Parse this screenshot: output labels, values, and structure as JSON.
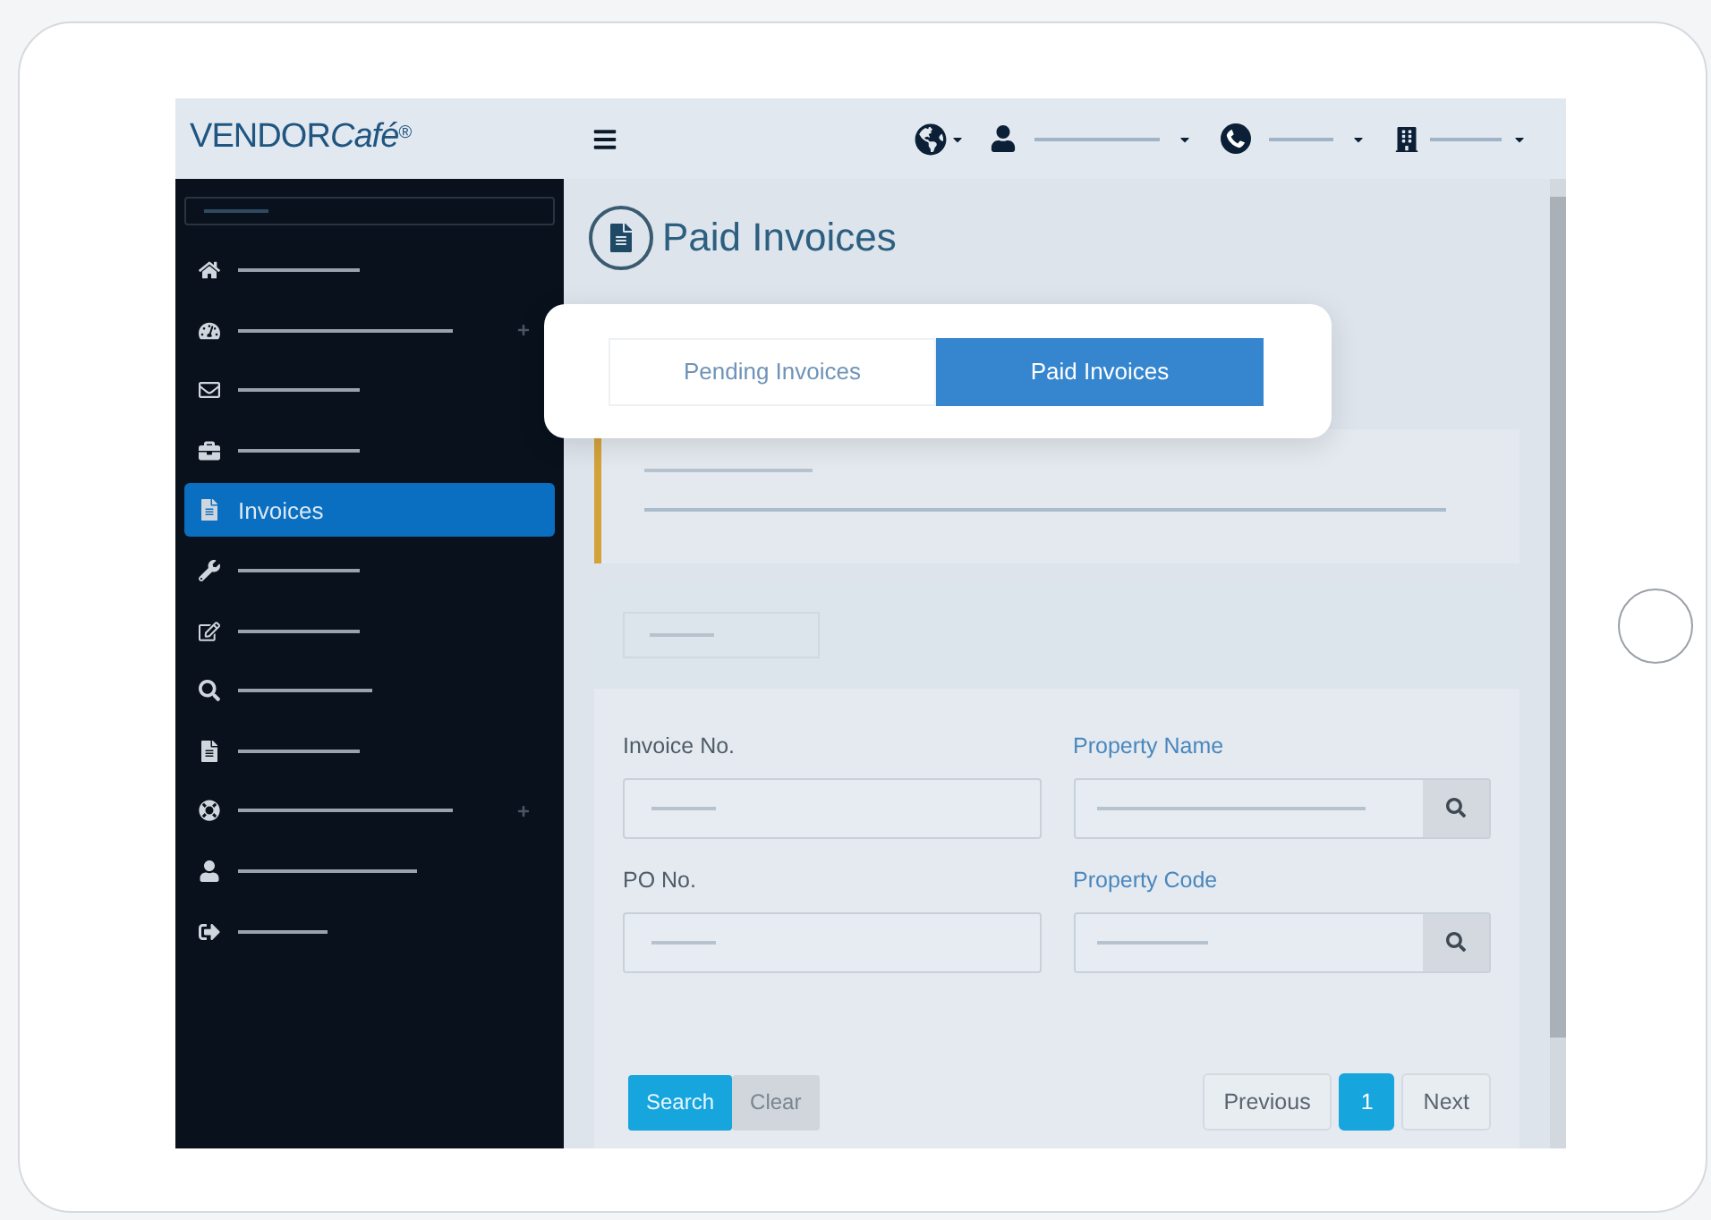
{
  "header": {
    "logo": {
      "name": "VENDOR",
      "suffix": "Café",
      "mark": "®"
    }
  },
  "sidebar": {
    "items": [
      {
        "selected": false,
        "expandable": false
      },
      {
        "selected": false,
        "expandable": true
      },
      {
        "selected": false,
        "expandable": false
      },
      {
        "selected": false,
        "expandable": false
      },
      {
        "selected": true,
        "expandable": false,
        "label": "Invoices"
      },
      {
        "selected": false,
        "expandable": false
      },
      {
        "selected": false,
        "expandable": false
      },
      {
        "selected": false,
        "expandable": false
      },
      {
        "selected": false,
        "expandable": false
      },
      {
        "selected": false,
        "expandable": true
      },
      {
        "selected": false,
        "expandable": false
      },
      {
        "selected": false,
        "expandable": false
      }
    ]
  },
  "page": {
    "title": "Paid Invoices"
  },
  "tabs": [
    {
      "label": "Pending Invoices",
      "selected": false
    },
    {
      "label": "Paid Invoices",
      "selected": true
    }
  ],
  "form": {
    "fields": [
      {
        "label": "Invoice No.",
        "kind": "text"
      },
      {
        "label": "Property Name",
        "kind": "lookup"
      },
      {
        "label": "PO No.",
        "kind": "text"
      },
      {
        "label": "Property Code",
        "kind": "lookup"
      }
    ],
    "buttons": [
      {
        "label": "Search",
        "kind": "primary"
      },
      {
        "label": "Clear",
        "kind": "secondary"
      }
    ]
  },
  "pagination": [
    {
      "label": "Previous",
      "selected": false
    },
    {
      "label": "1",
      "selected": true
    },
    {
      "label": "Next",
      "selected": false
    }
  ]
}
